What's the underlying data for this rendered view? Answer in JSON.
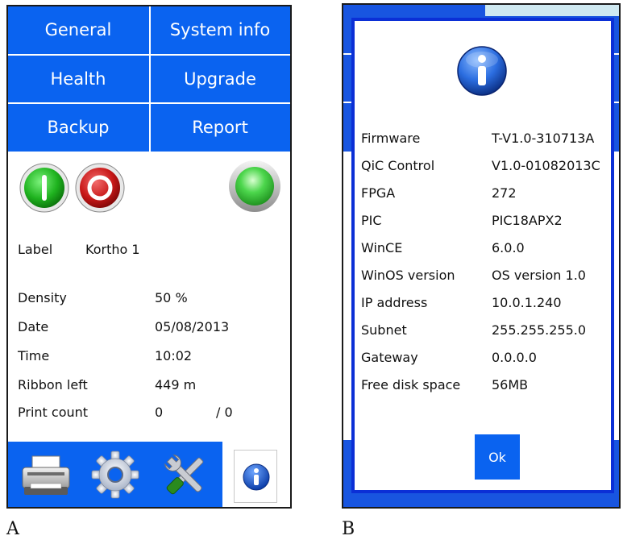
{
  "captions": {
    "a": "A",
    "b": "B"
  },
  "panel_a": {
    "menu": {
      "general": "General",
      "system_info": "System info",
      "health": "Health",
      "upgrade": "Upgrade",
      "backup": "Backup",
      "report": "Report"
    },
    "label_row": {
      "label": "Label",
      "value": "Kortho 1"
    },
    "stats": [
      {
        "label": "Density",
        "value": "50 %"
      },
      {
        "label": "Date",
        "value": "05/08/2013"
      },
      {
        "label": "Time",
        "value": "10:02"
      },
      {
        "label": "Ribbon left",
        "value": "449 m"
      },
      {
        "label": "Print count",
        "value": "0",
        "extra": "/ 0"
      }
    ],
    "icons": {
      "start": "power-on-icon",
      "stop": "stop-icon",
      "status": "status-led-icon",
      "printer": "printer-icon",
      "settings": "gear-icon",
      "tools": "tools-icon",
      "info": "info-icon"
    },
    "colors": {
      "accent": "#0a63f0",
      "on": "#1fb31f",
      "stop": "#c81818",
      "led": "#4cd64c"
    }
  },
  "panel_b": {
    "rows": [
      {
        "label": "Firmware",
        "value": "T-V1.0-310713A"
      },
      {
        "label": "QiC Control",
        "value": "V1.0-01082013C"
      },
      {
        "label": "FPGA",
        "value": "272"
      },
      {
        "label": "PIC",
        "value": "PIC18APX2"
      },
      {
        "label": "WinCE",
        "value": "6.0.0"
      },
      {
        "label": "WinOS version",
        "value": "OS version 1.0"
      },
      {
        "label": "IP address",
        "value": "10.0.1.240"
      },
      {
        "label": "Subnet",
        "value": "255.255.255.0"
      },
      {
        "label": "Gateway",
        "value": "0.0.0.0"
      },
      {
        "label": "Free disk space",
        "value": "56MB"
      }
    ],
    "ok_label": "Ok",
    "icons": {
      "header": "info-icon"
    },
    "colors": {
      "backdrop": "#1855e0",
      "dialog_border": "#0b2fd6"
    }
  }
}
